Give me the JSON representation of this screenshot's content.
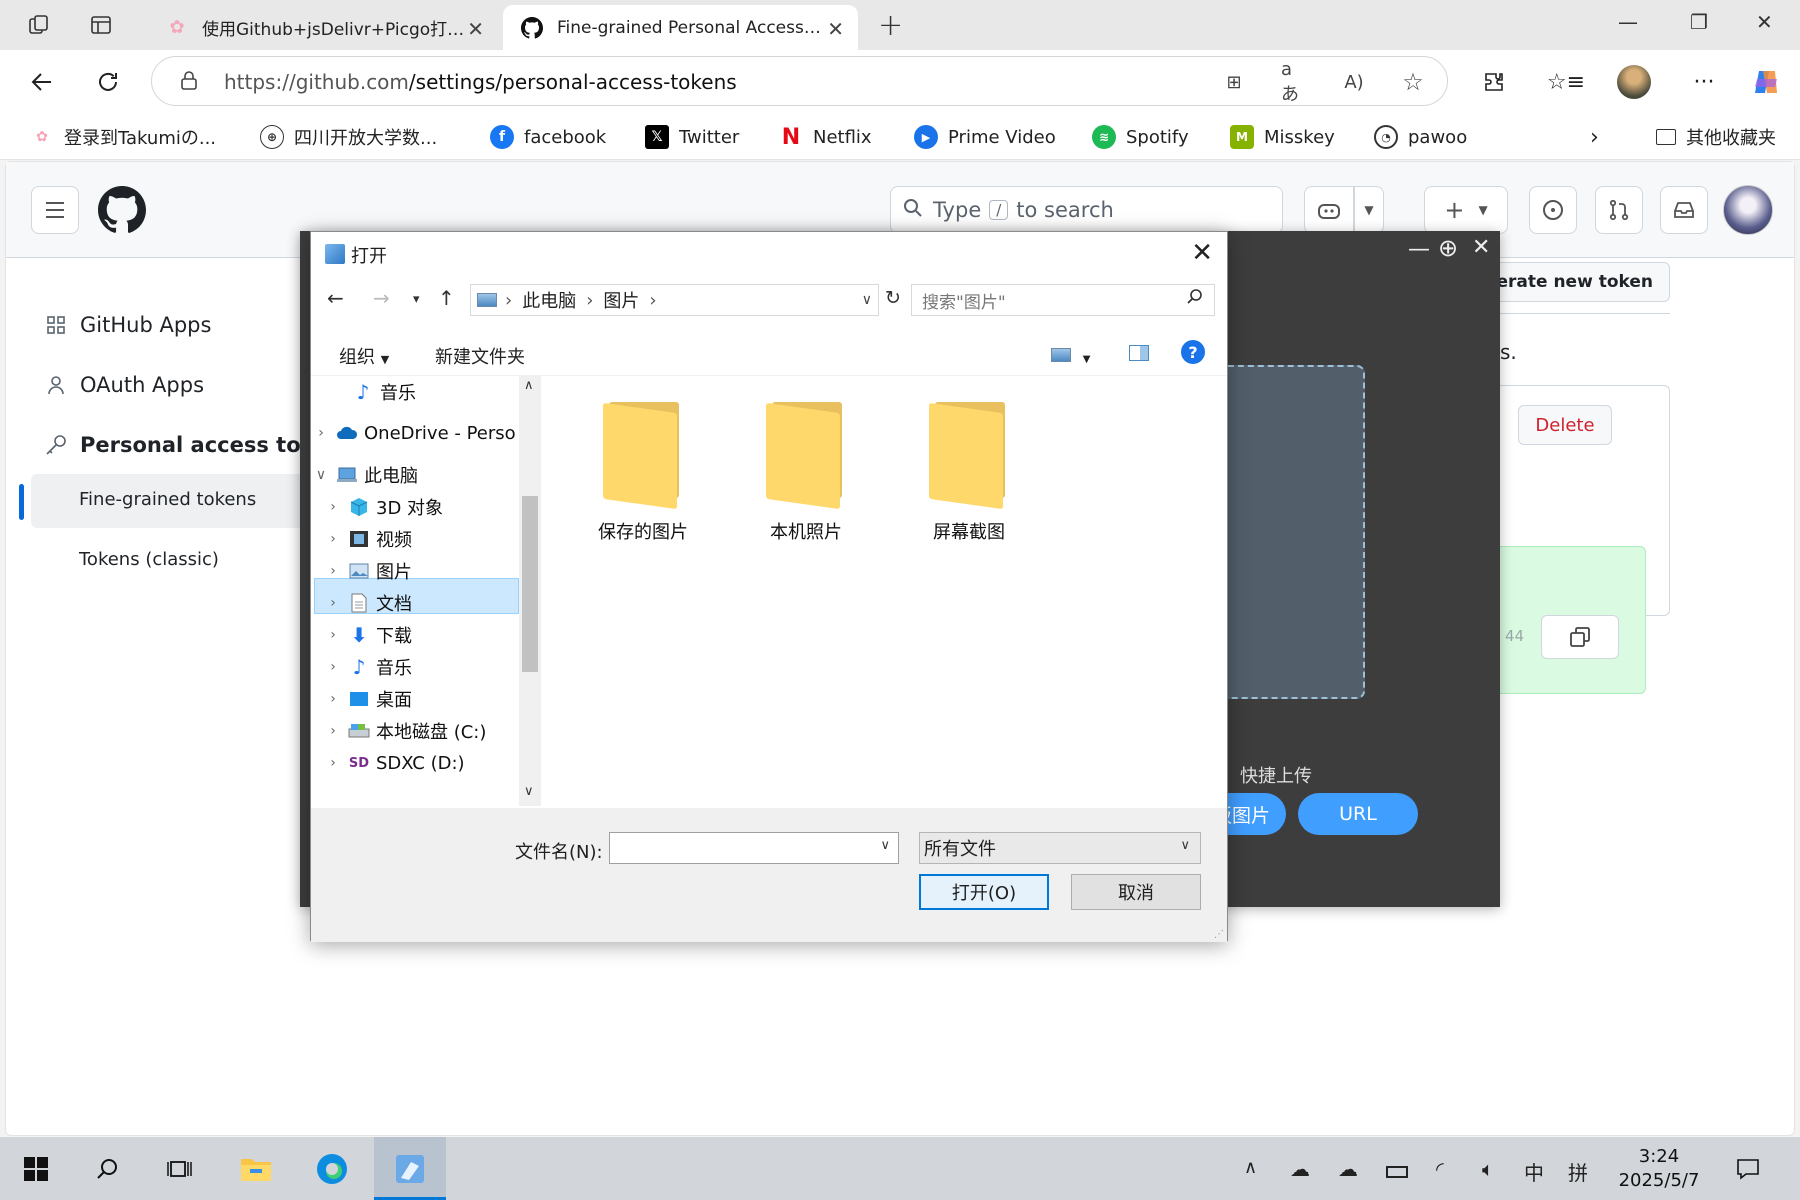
{
  "browser": {
    "tabs": [
      {
        "title": "使用Github+jsDelivr+Picgo打造免",
        "active": false
      },
      {
        "title": "Fine-grained Personal Access Tok",
        "active": true
      }
    ],
    "url_domain": "https://github.com",
    "url_path": "/settings/personal-access-tokens",
    "bookmarks": [
      {
        "label": "登录到Takumiの..."
      },
      {
        "label": "四川开放大学数..."
      },
      {
        "label": "facebook"
      },
      {
        "label": "Twitter"
      },
      {
        "label": "Netflix"
      },
      {
        "label": "Prime Video"
      },
      {
        "label": "Spotify"
      },
      {
        "label": "Misskey"
      },
      {
        "label": "pawoo"
      }
    ],
    "other_bookmarks": "其他收藏夹"
  },
  "github": {
    "search_type": "Type",
    "search_key": "/",
    "search_suffix": "to search",
    "sidebar": {
      "github_apps": "GitHub Apps",
      "oauth_apps": "OAuth Apps",
      "pat": "Personal access tokens",
      "fine_grained": "Fine-grained tokens",
      "classic": "Tokens (classic)"
    },
    "generate_button": "nerate new token",
    "delete_button": "Delete",
    "period_fragment": "s.",
    "token_fragment": "44"
  },
  "picgo": {
    "quick_upload": "快捷上传",
    "clipboard_button": "板图片",
    "url_button": "URL"
  },
  "dialog": {
    "title": "打开",
    "breadcrumb": [
      "此电脑",
      "图片"
    ],
    "search_placeholder": "搜索\"图片\"",
    "organize": "组织",
    "new_folder": "新建文件夹",
    "tree": [
      {
        "label": "音乐",
        "icon": "music-icon"
      },
      {
        "label": "OneDrive - Perso",
        "icon": "onedrive-icon"
      },
      {
        "label": "此电脑",
        "icon": "computer-icon"
      },
      {
        "label": "3D 对象",
        "icon": "cube-icon"
      },
      {
        "label": "视频",
        "icon": "video-icon"
      },
      {
        "label": "图片",
        "icon": "pictures-icon"
      },
      {
        "label": "文档",
        "icon": "document-icon"
      },
      {
        "label": "下载",
        "icon": "download-icon"
      },
      {
        "label": "音乐",
        "icon": "music-icon"
      },
      {
        "label": "桌面",
        "icon": "desktop-icon"
      },
      {
        "label": "本地磁盘 (C:)",
        "icon": "disk-icon"
      },
      {
        "label": "SDXC (D:)",
        "icon": "sd-card-icon"
      }
    ],
    "folders": [
      "保存的图片",
      "本机照片",
      "屏幕截图"
    ],
    "filename_label": "文件名(N):",
    "filename_value": "",
    "filetype": "所有文件",
    "open_button": "打开(O)",
    "cancel_button": "取消"
  },
  "taskbar": {
    "time": "3:24",
    "date": "2025/5/7",
    "ime": "中",
    "ime2": "拼"
  },
  "colors": {
    "accent_blue": "#0969da",
    "delete_red": "#cf222e",
    "picgo_blue": "#409eff",
    "selection": "#cce8ff"
  }
}
